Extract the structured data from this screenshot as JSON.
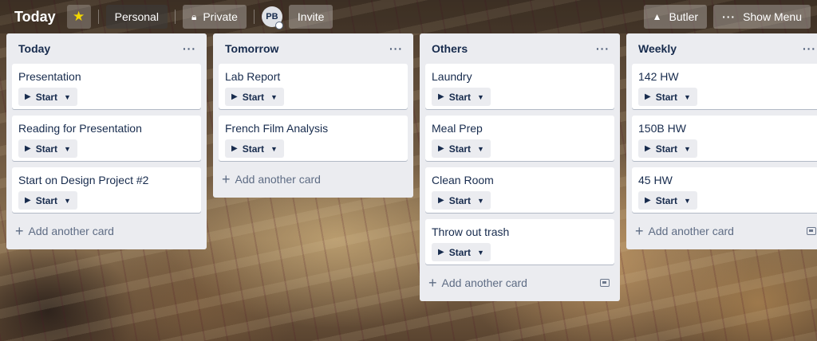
{
  "header": {
    "board_title": "Today",
    "star_icon": "★",
    "personal_label": "Personal",
    "private_label": "Private",
    "avatar_initials": "PB",
    "invite_label": "Invite",
    "butler_label": "Butler",
    "show_menu_label": "Show Menu"
  },
  "lists": [
    {
      "title": "Today",
      "cards": [
        {
          "title": "Presentation",
          "button": "Start"
        },
        {
          "title": "Reading for Presentation",
          "button": "Start"
        },
        {
          "title": "Start on Design Project #2",
          "button": "Start"
        }
      ],
      "add_card_label": "Add another card"
    },
    {
      "title": "Tomorrow",
      "cards": [
        {
          "title": "Lab Report",
          "button": "Start"
        },
        {
          "title": "French Film Analysis",
          "button": "Start"
        }
      ],
      "add_card_label": "Add another card"
    },
    {
      "title": "Others",
      "cards": [
        {
          "title": "Laundry",
          "button": "Start"
        },
        {
          "title": "Meal Prep",
          "button": "Start"
        },
        {
          "title": "Clean Room",
          "button": "Start"
        },
        {
          "title": "Throw out trash",
          "button": "Start"
        }
      ],
      "add_card_label": "Add another card"
    },
    {
      "title": "Weekly",
      "cards": [
        {
          "title": "142 HW",
          "button": "Start"
        },
        {
          "title": "150B HW",
          "button": "Start"
        },
        {
          "title": "45 HW",
          "button": "Start"
        }
      ],
      "add_card_label": "Add another card"
    }
  ]
}
